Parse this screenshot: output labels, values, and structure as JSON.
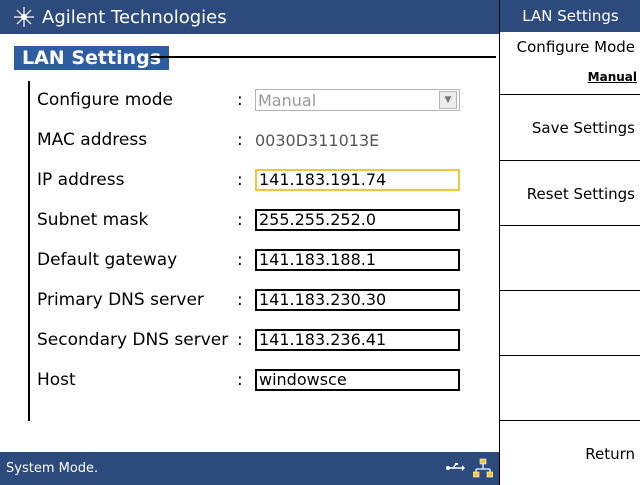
{
  "app": {
    "brand": "Agilent Technologies"
  },
  "section": {
    "title": "LAN Settings"
  },
  "form": {
    "configure_mode": {
      "label": "Configure mode",
      "value": "Manual"
    },
    "mac_address": {
      "label": "MAC address",
      "value": "0030D311013E"
    },
    "ip_address": {
      "label": "IP address",
      "value": "141.183.191.74"
    },
    "subnet_mask": {
      "label": "Subnet mask",
      "value": "255.255.252.0"
    },
    "default_gateway": {
      "label": "Default gateway",
      "value": "141.183.188.1"
    },
    "primary_dns": {
      "label": "Primary DNS server",
      "value": "141.183.230.30"
    },
    "secondary_dns": {
      "label": "Secondary DNS server",
      "value": "141.183.236.41"
    },
    "host": {
      "label": "Host",
      "value": "windowsce"
    },
    "separator": ":"
  },
  "status": {
    "text": "System Mode."
  },
  "softkeys": {
    "header": "LAN Settings",
    "configure_mode": {
      "label": "Configure Mode",
      "sub": "Manual"
    },
    "save": "Save Settings",
    "reset": "Reset Settings",
    "return": "Return"
  },
  "colors": {
    "bar": "#2c4a7c",
    "accent": "#2e5da1",
    "focus": "#f2c53a"
  },
  "icons": [
    "agilent-logo-icon",
    "usb-icon",
    "network-icon"
  ]
}
